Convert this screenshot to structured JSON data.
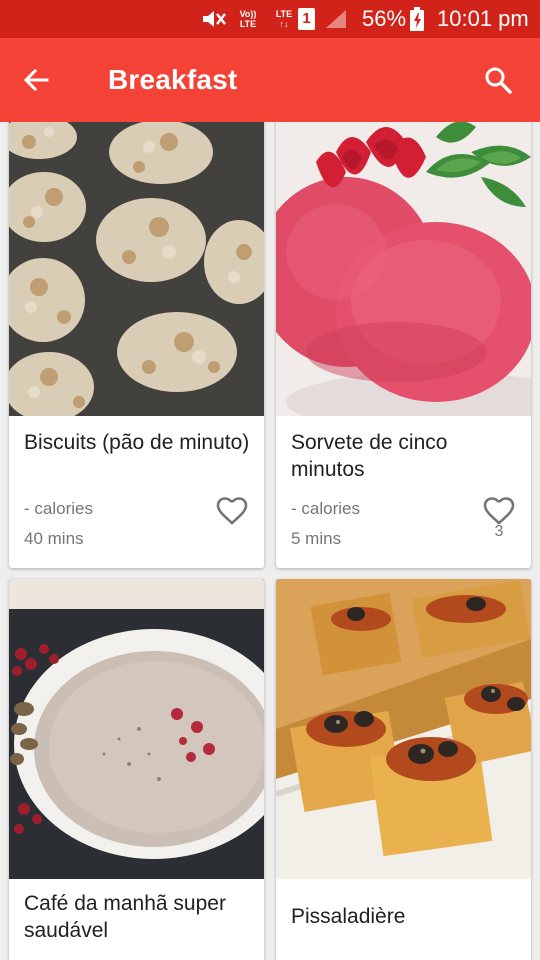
{
  "status_bar": {
    "volte": [
      "Vo))",
      "LTE"
    ],
    "lte": [
      "LTE",
      "↑↓"
    ],
    "sim": "1",
    "battery": "56%",
    "time": "10:01 pm"
  },
  "app_bar": {
    "title": "Breakfast",
    "back_icon": "arrow-back-icon",
    "search_icon": "search-icon",
    "color": "#f44336"
  },
  "recipes": [
    {
      "title": "Biscuits (pão de minuto)",
      "calories": "- calories",
      "time": "40 mins",
      "favorites": ""
    },
    {
      "title": "Sorvete de cinco minutos",
      "calories": "- calories",
      "time": "5 mins",
      "favorites": "3"
    },
    {
      "title": "Café da manhã super saudável",
      "calories": "",
      "time": "",
      "favorites": ""
    },
    {
      "title": "Pissaladière",
      "calories": "",
      "time": "",
      "favorites": ""
    }
  ]
}
